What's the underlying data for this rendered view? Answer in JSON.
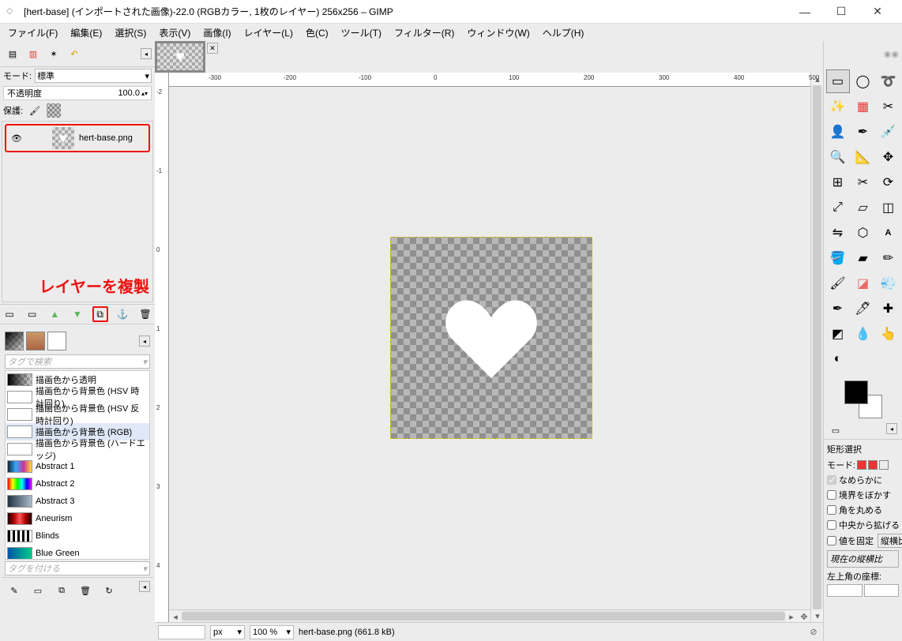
{
  "title": "[hert-base] (インポートされた画像)-22.0 (RGBカラー, 1枚のレイヤー) 256x256 – GIMP",
  "menu": [
    "ファイル(F)",
    "編集(E)",
    "選択(S)",
    "表示(V)",
    "画像(I)",
    "レイヤー(L)",
    "色(C)",
    "ツール(T)",
    "フィルター(R)",
    "ウィンドウ(W)",
    "ヘルプ(H)"
  ],
  "mode_label": "モード:",
  "mode_value": "標準",
  "opacity_label": "不透明度",
  "opacity_value": "100.0",
  "protect_label": "保護:",
  "layer_name": "hert-base.png",
  "annotation": "レイヤーを複製",
  "tag_search_placeholder": "タグで検索",
  "tag_add_placeholder": "タグを付ける",
  "gradients": [
    {
      "name": "描画色から透明",
      "g": "linear-gradient(to right,#000,transparent)"
    },
    {
      "name": "描画色から背景色 (HSV 時計回り)",
      "g": "#fff"
    },
    {
      "name": "描画色から背景色 (HSV 反時計回り)",
      "g": "#fff"
    },
    {
      "name": "描画色から背景色 (RGB)",
      "g": "#fff"
    },
    {
      "name": "描画色から背景色 (ハードエッジ)",
      "g": "#fff"
    },
    {
      "name": "Abstract 1",
      "g": "linear-gradient(to right,#123,#3af,#c39,#fd3)"
    },
    {
      "name": "Abstract 2",
      "g": "linear-gradient(to right,#f00,#ff0,#0f0,#0ff,#00f,#f0f)"
    },
    {
      "name": "Abstract 3",
      "g": "linear-gradient(to right,#234,#678,#abc)"
    },
    {
      "name": "Aneurism",
      "g": "linear-gradient(to right,#200,#a00,#f55,#a00,#200)"
    },
    {
      "name": "Blinds",
      "g": "repeating-linear-gradient(to right,#000 0 3px,#fff 3px 6px)"
    },
    {
      "name": "Blue Green",
      "g": "linear-gradient(to right,#05a,#0c8)"
    }
  ],
  "tool_options": {
    "title": "矩形選択",
    "mode_label": "モード:",
    "smooth": "なめらかに",
    "blur_edge": "境界をぼかす",
    "round_corner": "角を丸める",
    "center_out": "中央から拡げる",
    "fixed": "値を固定",
    "fixed_btn": "縦横比",
    "current_ratio": "現在の縦横比",
    "corner_label": "左上角の座標:"
  },
  "zoom_unit": "px",
  "zoom_value": "100 %",
  "status_text": "hert-base.png (661.8 kB)",
  "ruler_ticks_h": [
    "-300",
    "-200",
    "-100",
    "0",
    "100",
    "200",
    "300",
    "400",
    "500"
  ],
  "ruler_ticks_v": [
    "-2",
    "-1",
    "0",
    "1",
    "2",
    "3",
    "4"
  ]
}
